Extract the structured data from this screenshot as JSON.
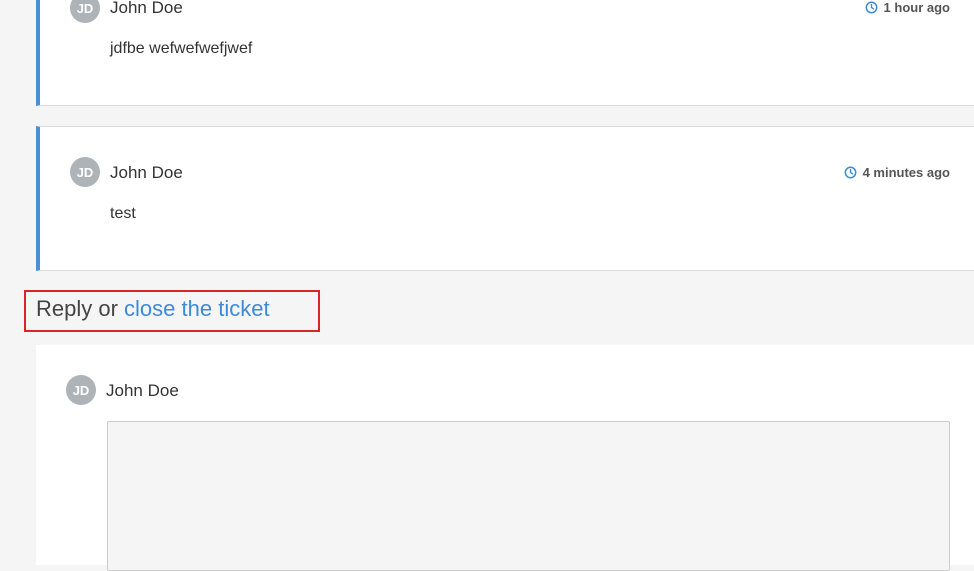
{
  "comments": [
    {
      "avatar_initials": "JD",
      "author": "John Doe",
      "time": "1 hour ago",
      "time_icon": "clock-icon",
      "text": "jdfbe wefwefwefjwef"
    },
    {
      "avatar_initials": "JD",
      "author": "John Doe",
      "time": "4 minutes ago",
      "time_icon": "clock-icon",
      "text": "test"
    }
  ],
  "reply_section": {
    "prefix": "Reply or ",
    "close_link": "close the ticket",
    "avatar_initials": "JD",
    "author": "John Doe",
    "textarea_value": ""
  },
  "colors": {
    "accent_border": "#4a90d9",
    "link": "#3d8ad9",
    "highlight_box": "#d9242a",
    "avatar_bg": "#aeb3b7"
  }
}
